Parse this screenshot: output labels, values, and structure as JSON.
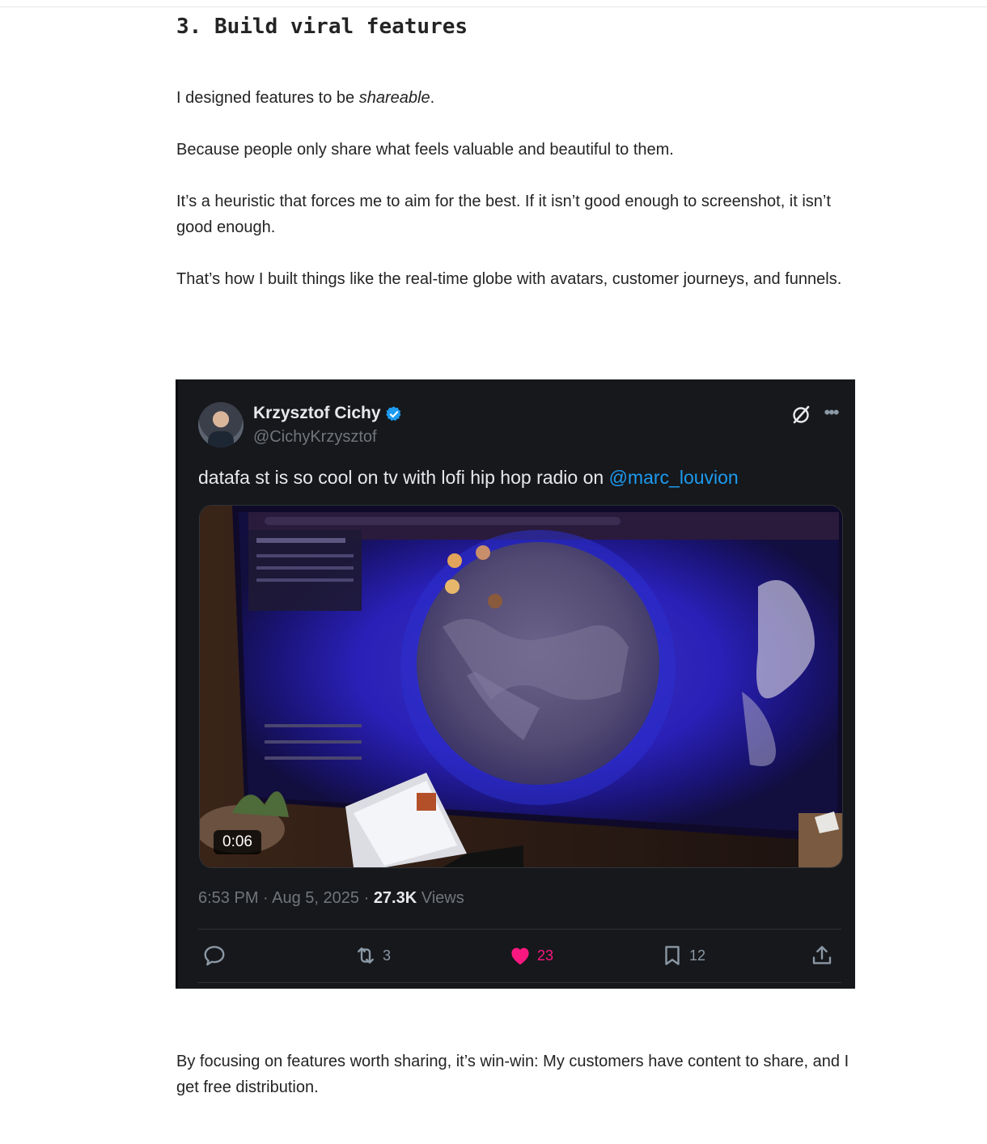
{
  "article": {
    "heading": "3. Build viral features",
    "p1_before": "I designed features to be ",
    "p1_em": "shareable",
    "p1_after": ".",
    "p2": "Because people only share what feels valuable and beautiful to them.",
    "p3": "It’s a heuristic that forces me to aim for the best. If it isn’t good enough to screenshot, it isn’t good enough.",
    "p4": "That’s how I built things like the real-time globe with avatars, customer journeys, and funnels.",
    "p5": "By focusing on features worth sharing, it’s win-win: My customers have content to share, and I get free distribution."
  },
  "tweet": {
    "author_name": "Krzysztof Cichy",
    "author_handle": "@CichyKrzysztof",
    "text_before": "datafa st is so cool on tv with lofi hip hop radio on ",
    "mention": "@marc_louvion",
    "video_duration": "0:06",
    "time": "6:53 PM",
    "date": "Aug 5, 2025",
    "views_count": "27.3K",
    "views_label": "Views",
    "retweets": "3",
    "likes": "23",
    "bookmarks": "12",
    "icons": [
      "verified-badge-icon",
      "grok-icon",
      "more-icon",
      "reply-icon",
      "retweet-icon",
      "heart-icon",
      "bookmark-icon",
      "share-icon"
    ],
    "colors": {
      "background": "#16181c",
      "link": "#1d9bf0",
      "like": "#f91880",
      "verified": "#1d9bf0",
      "muted": "#71767b"
    }
  }
}
